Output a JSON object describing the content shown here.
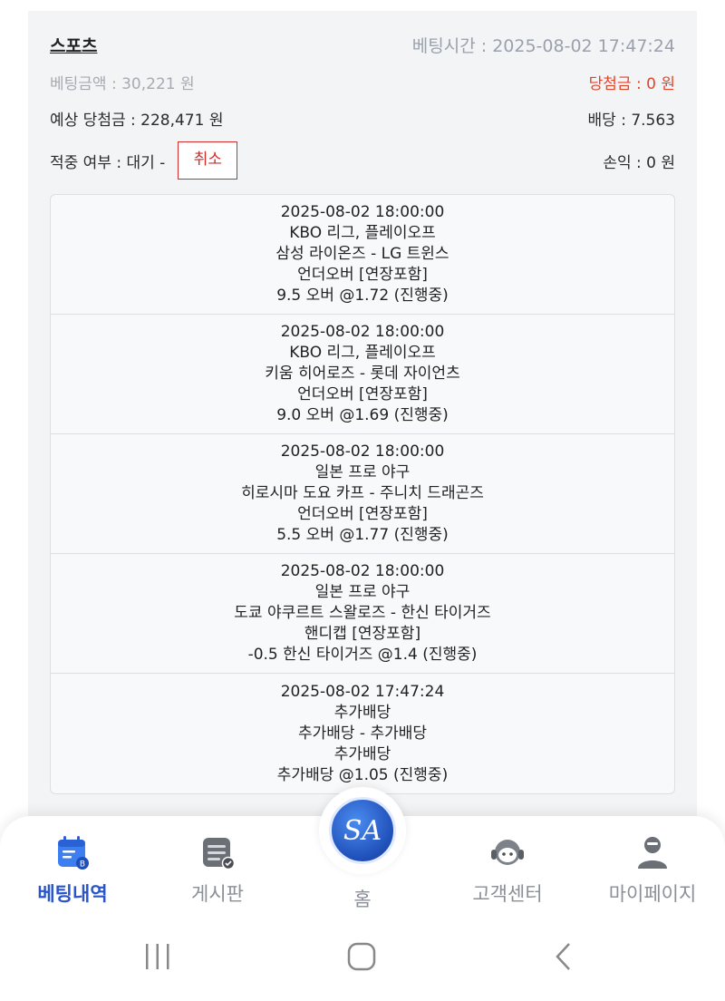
{
  "header": {
    "title": "스포츠",
    "bet_time": "베팅시간 : 2025-08-02 17:47:24"
  },
  "summary": {
    "bet_amount": "베팅금액 : 30,221 원",
    "win_amount": "당첨금 : 0 원",
    "expected_win": "예상 당첨금 : 228,471 원",
    "odds": "배당 : 7.563",
    "hit_status": "적중 여부 : 대기 -",
    "cancel_label": "취소",
    "profit": "손익 : 0 원"
  },
  "bets": [
    {
      "datetime": "2025-08-02 18:00:00",
      "league": "KBO 리그, 플레이오프",
      "match": "삼성 라이온즈 - LG 트윈스",
      "market": "언더오버 [연장포함]",
      "pick": "9.5 오버 @1.72 (진행중)"
    },
    {
      "datetime": "2025-08-02 18:00:00",
      "league": "KBO 리그, 플레이오프",
      "match": "키움 히어로즈 - 롯데 자이언츠",
      "market": "언더오버 [연장포함]",
      "pick": "9.0 오버 @1.69 (진행중)"
    },
    {
      "datetime": "2025-08-02 18:00:00",
      "league": "일본 프로 야구",
      "match": "히로시마 도요 카프 - 주니치 드래곤즈",
      "market": "언더오버 [연장포함]",
      "pick": "5.5 오버 @1.77 (진행중)"
    },
    {
      "datetime": "2025-08-02 18:00:00",
      "league": "일본 프로 야구",
      "match": "도쿄 야쿠르트 스왈로즈 - 한신 타이거즈",
      "market": "핸디캡 [연장포함]",
      "pick": "-0.5 한신 타이거즈 @1.4 (진행중)"
    },
    {
      "datetime": "2025-08-02 17:47:24",
      "league": "추가배당",
      "match": "추가배당 - 추가배당",
      "market": "추가배당",
      "pick": "추가배당 @1.05 (진행중)"
    }
  ],
  "nav": {
    "items": [
      {
        "label": "베팅내역",
        "icon": "calendar-icon",
        "active": true
      },
      {
        "label": "게시판",
        "icon": "board-icon",
        "active": false
      },
      {
        "label": "홈",
        "icon": "home-logo-icon",
        "active": false
      },
      {
        "label": "고객센터",
        "icon": "support-icon",
        "active": false
      },
      {
        "label": "마이페이지",
        "icon": "user-icon",
        "active": false
      }
    ],
    "home_logo_text": "SA"
  },
  "colors": {
    "accent": "#2a55c9",
    "danger": "#d42b2b",
    "muted": "#9aa1ad"
  },
  "system_bar": [
    "recent-apps-icon",
    "home-button-icon",
    "back-icon"
  ]
}
